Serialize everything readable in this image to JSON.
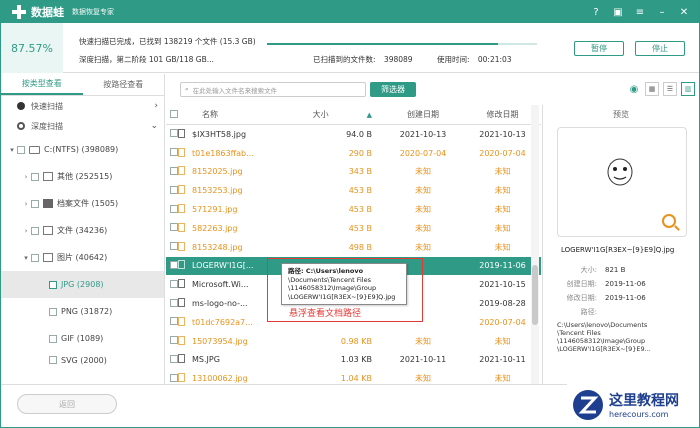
{
  "titlebar": {
    "app_name": "数据蛙",
    "subtitle": "数据恢复专家",
    "logo_symbol": "+"
  },
  "scan": {
    "percent": "87.57%",
    "line1": "快速扫描已完成，已找到 138219 个文件 (15.3 GB)",
    "line2": "深度扫描，第二阶段 101 GB/118 GB...",
    "found_label": "已扫描到的文件数:",
    "found_value": "398089",
    "time_label": "使用时间:",
    "time_value": "00:21:03",
    "progress": 0.857,
    "pause_label": "暂停",
    "stop_label": "停止"
  },
  "left": {
    "tabs": [
      "按类型查看",
      "按路径查看"
    ],
    "quick_scan": "快速扫描",
    "deep_scan": "深度扫描",
    "tree": [
      {
        "label": "C:(NTFS) (398089)"
      },
      {
        "label": "其他 (252515)"
      },
      {
        "label": "档案文件 (1505)"
      },
      {
        "label": "文件 (34236)"
      },
      {
        "label": "图片 (40642)"
      },
      {
        "label": "JPG (2908)"
      },
      {
        "label": "PNG (31872)"
      },
      {
        "label": "GIF (1089)"
      },
      {
        "label": "SVG (2000)"
      }
    ]
  },
  "toolbar": {
    "search_placeholder": "在此处输入文件名来搜索文件",
    "filter_label": "筛选器"
  },
  "table": {
    "headers": {
      "name": "名称",
      "size": "大小",
      "created": "创建日期",
      "modified": "修改日期"
    },
    "rows": [
      {
        "name": "$IX3HT58.jpg",
        "size": "94.0 B",
        "created": "2021-10-13",
        "modified": "2021-10-13",
        "style": "normal"
      },
      {
        "name": "t01e1863ffab...",
        "size": "290 B",
        "created": "2020-07-04",
        "modified": "2020-07-04",
        "style": "orange"
      },
      {
        "name": "8152025.jpg",
        "size": "343 B",
        "created": "未知",
        "modified": "未知",
        "style": "orange"
      },
      {
        "name": "8153253.jpg",
        "size": "453 B",
        "created": "未知",
        "modified": "未知",
        "style": "orange"
      },
      {
        "name": "571291.jpg",
        "size": "453 B",
        "created": "未知",
        "modified": "未知",
        "style": "orange"
      },
      {
        "name": "582263.jpg",
        "size": "453 B",
        "created": "未知",
        "modified": "未知",
        "style": "orange"
      },
      {
        "name": "8153248.jpg",
        "size": "498 B",
        "created": "未知",
        "modified": "未知",
        "style": "orange"
      },
      {
        "name": "LOGERW'I1G[...",
        "size": "",
        "created": "",
        "modified": "2019-11-06",
        "style": "sel"
      },
      {
        "name": "Microsoft.Wi...",
        "size": "",
        "created": "",
        "modified": "2021-10-15",
        "style": "normal"
      },
      {
        "name": "ms-logo-no-...",
        "size": "",
        "created": "",
        "modified": "2019-08-28",
        "style": "normal"
      },
      {
        "name": "t01dc7692a7...",
        "size": "",
        "created": "",
        "modified": "2020-07-04",
        "style": "orange"
      },
      {
        "name": "15073954.jpg",
        "size": "0.98 KB",
        "created": "未知",
        "modified": "未知",
        "style": "orange"
      },
      {
        "name": "MS.JPG",
        "size": "1.03 KB",
        "created": "2021-10-11",
        "modified": "2021-10-11",
        "style": "normal"
      },
      {
        "name": "13100062.jpg",
        "size": "1.04 KB",
        "created": "未知",
        "modified": "未知",
        "style": "orange"
      }
    ]
  },
  "tooltip": {
    "line1": "路径:  C:\\Users\\lenovo",
    "line2": "\\Documents\\Tencent Files",
    "line3": "\\1146058312\\Image\\Group",
    "line4": "\\LOGERW'I1G[R3EX~[9}E9]Q.jpg",
    "annotation": "悬浮查看文档路径"
  },
  "preview": {
    "title": "预览",
    "filename": "LOGERW'I1G[R3EX~[9}E9]Q.jpg",
    "size_label": "大小:",
    "size_value": "821 B",
    "created_label": "创建日期:",
    "created_value": "2019-11-06",
    "modified_label": "修改日期:",
    "modified_value": "2019-11-06",
    "path_label": "路径:",
    "path_lines": [
      "C:\\Users\\lenovo\\Documents",
      "\\Tencent Files",
      "\\1146058312\\Image\\Group",
      "\\LOGERW'I1G[R3EX~[9}E9..."
    ]
  },
  "bottom": {
    "back_label": "返回"
  },
  "watermark": {
    "title": "这里教程网",
    "url": "herecours.com"
  },
  "colors": {
    "accent": "#2f9b87",
    "orange": "#e8921b",
    "red": "#e53935"
  }
}
